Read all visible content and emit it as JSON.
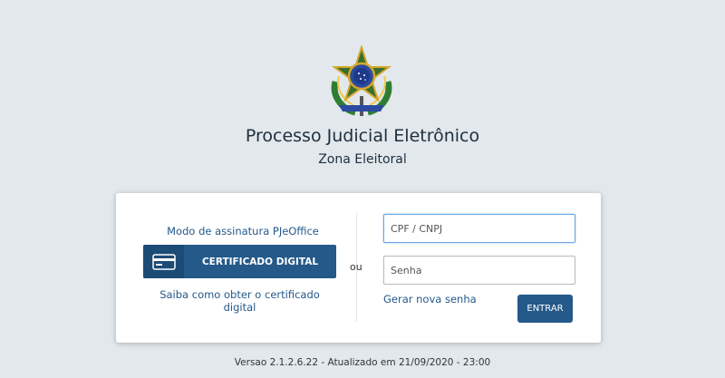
{
  "header": {
    "emblem_icon": "brazil-coat-of-arms-icon",
    "title": "Processo Judicial Eletrônico",
    "subtitle": "Zona Eleitoral"
  },
  "certificate": {
    "mode_link": "Modo de assinatura PJeOffice",
    "button_icon": "credit-card-icon",
    "button_label": "CERTIFICADO DIGITAL",
    "how_to_link": "Saiba como obter o certificado digital"
  },
  "separator": "ou",
  "login": {
    "cpf_placeholder": "CPF / CNPJ",
    "cpf_value": "",
    "password_placeholder": "Senha",
    "password_value": "",
    "forgot_link": "Gerar nova senha",
    "enter_label": "ENTRAR"
  },
  "footer": {
    "version": "Versao 2.1.2.6.22 - Atualizado em 21/09/2020 - 23:00"
  },
  "colors": {
    "background": "#e2e8ec",
    "primary": "#24598a",
    "primary_dark": "#1c4b76",
    "panel": "#ffffff"
  }
}
